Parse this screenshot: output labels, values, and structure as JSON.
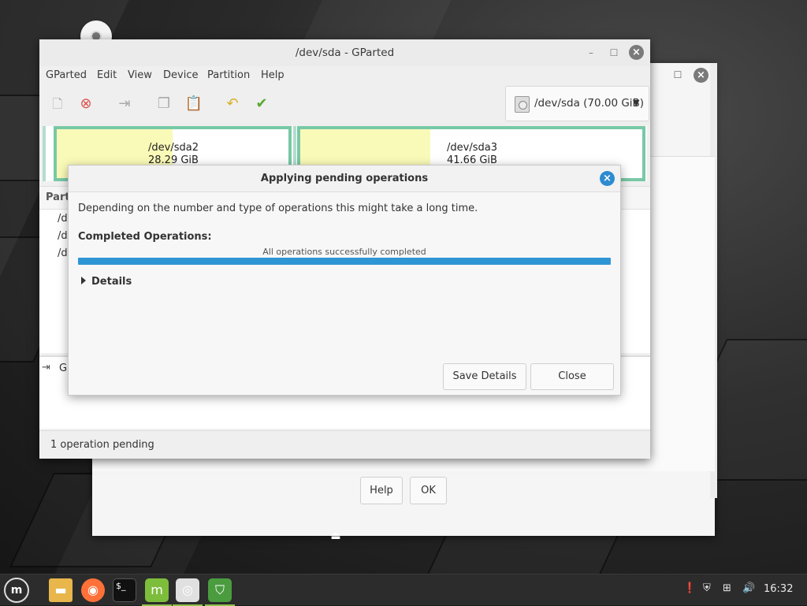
{
  "gparted": {
    "title": "/dev/sda - GParted",
    "menu": [
      "GParted",
      "Edit",
      "View",
      "Device",
      "Partition",
      "Help"
    ],
    "device_selector": "/dev/sda (70.00 GiB)",
    "partitions": [
      {
        "name": "/dev/sda2",
        "size": "28.29 GiB",
        "used_fraction": 0.5
      },
      {
        "name": "/dev/sda3",
        "size": "41.66 GiB",
        "used_fraction": 0.38
      }
    ],
    "list_header_partial": "Parti",
    "list_rows_partial": [
      "/d",
      "/d",
      "/d"
    ],
    "ops_text_partial": "Gr",
    "status": "1 operation pending"
  },
  "apply_dialog": {
    "title": "Applying pending operations",
    "description": "Depending on the number and type of operations this might take a long time.",
    "completed_label": "Completed Operations:",
    "status_text": "All operations successfully completed",
    "progress": 1.0,
    "details_label": "Details",
    "save_details_label": "Save Details",
    "close_label": "Close"
  },
  "back_dialog": {
    "help_label": "Help",
    "ok_label": "OK"
  },
  "taskbar": {
    "clock": "16:32",
    "apps": [
      "menu-icon",
      "files-icon",
      "firefox-icon",
      "terminal-icon",
      "software-manager-icon",
      "chromium-icon",
      "shield-icon"
    ]
  }
}
